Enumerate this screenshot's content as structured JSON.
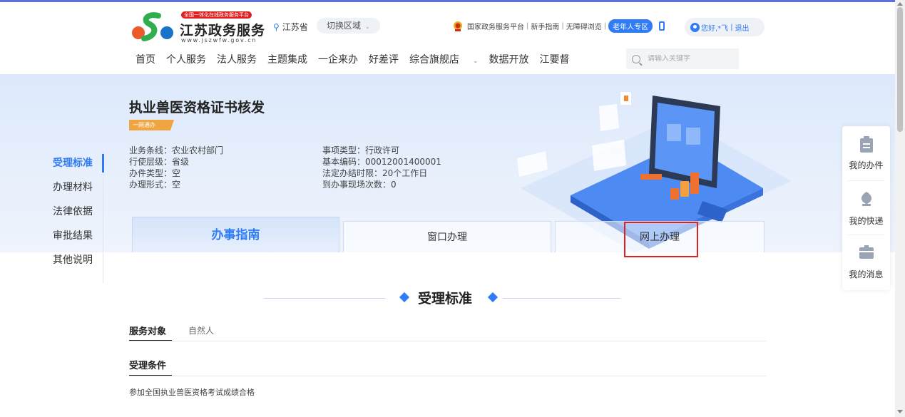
{
  "header": {
    "logo_badge": "全国一体化在线政务服务平台",
    "logo_title": "江苏政务服务",
    "logo_url": "www.jszwfw.gov.cn",
    "location": "江苏省",
    "region_button": "切换区域",
    "links": [
      "国家政务服务平台",
      "新手指南",
      "无障碍浏览"
    ],
    "elder_badge": "老年人专区",
    "user_greeting": "您好,*飞",
    "logout": "退出"
  },
  "nav": {
    "items": [
      "首页",
      "个人服务",
      "法人服务",
      "主题集成",
      "一企来办",
      "好差评",
      "综合旗舰店",
      "数据开放",
      "江要督"
    ],
    "search_placeholder": "请输入关键字"
  },
  "side_nav": {
    "items": [
      "受理标准",
      "办理材料",
      "法律依据",
      "审批结果",
      "其他说明"
    ],
    "active_index": 0
  },
  "banner": {
    "title": "执业兽医资格证书核发",
    "tag": "一网通办",
    "info_left": [
      "业务条线：农业农村部门",
      "行使层级：省级",
      "办件类型：空",
      "办理形式：空"
    ],
    "info_right": [
      "事项类型：行政许可",
      "基本编码：00012001400001",
      "法定办结时限：20个工作日",
      "到办事现场次数：0"
    ]
  },
  "tabs": [
    "办事指南",
    "窗口办理",
    "网上办理"
  ],
  "float_panel": [
    "我的办件",
    "我的快递",
    "我的消息"
  ],
  "section": {
    "title": "受理标准",
    "service_label": "服务对象",
    "service_value": "自然人",
    "condition_label": "受理条件",
    "condition_text": "参加全国执业兽医资格考试成绩合格"
  },
  "colors": {
    "accent": "#2f7cf6",
    "highlight": "#e02020",
    "tag": "#f0a640"
  }
}
